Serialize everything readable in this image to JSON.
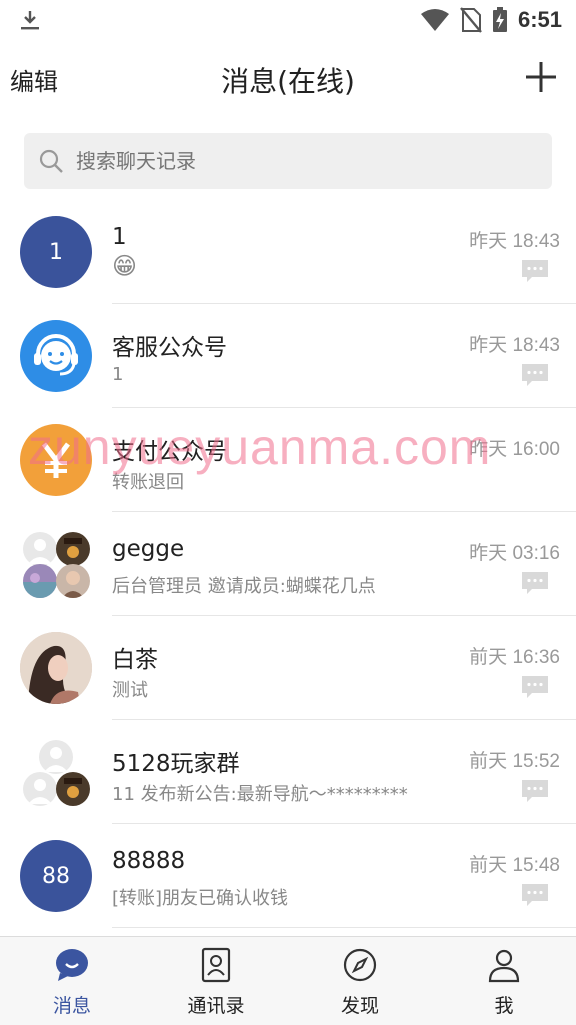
{
  "status_bar": {
    "time": "6:51",
    "icons": [
      "download-icon",
      "wifi-icon",
      "no-sim-icon",
      "battery-charging-icon"
    ]
  },
  "header": {
    "edit_label": "编辑",
    "title": "消息(在线)",
    "add_icon": "plus-icon"
  },
  "search": {
    "placeholder": "搜索聊天记录"
  },
  "chats": [
    {
      "name": "1",
      "preview": "😁",
      "time": "昨天 18:43",
      "avatar_text": "1",
      "avatar_color": "#3a539b"
    },
    {
      "name": "客服公众号",
      "preview": "1",
      "time": "昨天 18:43",
      "avatar_color": "#2e8de6",
      "avatar_icon": "headset-face-icon"
    },
    {
      "name": "支付公众号",
      "preview": "转账退回",
      "time": "昨天 16:00",
      "avatar_color": "#f2a03a",
      "avatar_icon": "yen-icon"
    },
    {
      "name": "gegge",
      "preview": "后台管理员 邀请成员:蝴蝶花几点",
      "time": "昨天 03:16"
    },
    {
      "name": "白茶",
      "preview": "测试",
      "time": "前天 16:36"
    },
    {
      "name": "5128玩家群",
      "preview": "11 发布新公告:最新导航～*********",
      "time": "前天 15:52"
    },
    {
      "name": "88888",
      "preview": "[转账]朋友已确认收钱",
      "time": "前天 15:48",
      "avatar_text": "88",
      "avatar_color": "#3a539b"
    }
  ],
  "watermark": "zunyueyuanma.com",
  "bottom_nav": [
    {
      "label": "消息",
      "icon": "chat-bubble-icon",
      "active": true
    },
    {
      "label": "通讯录",
      "icon": "contacts-icon",
      "active": false
    },
    {
      "label": "发现",
      "icon": "compass-icon",
      "active": false
    },
    {
      "label": "我",
      "icon": "person-icon",
      "active": false
    }
  ],
  "colors": {
    "accent": "#3b55a0",
    "search_bg": "#efefef"
  }
}
